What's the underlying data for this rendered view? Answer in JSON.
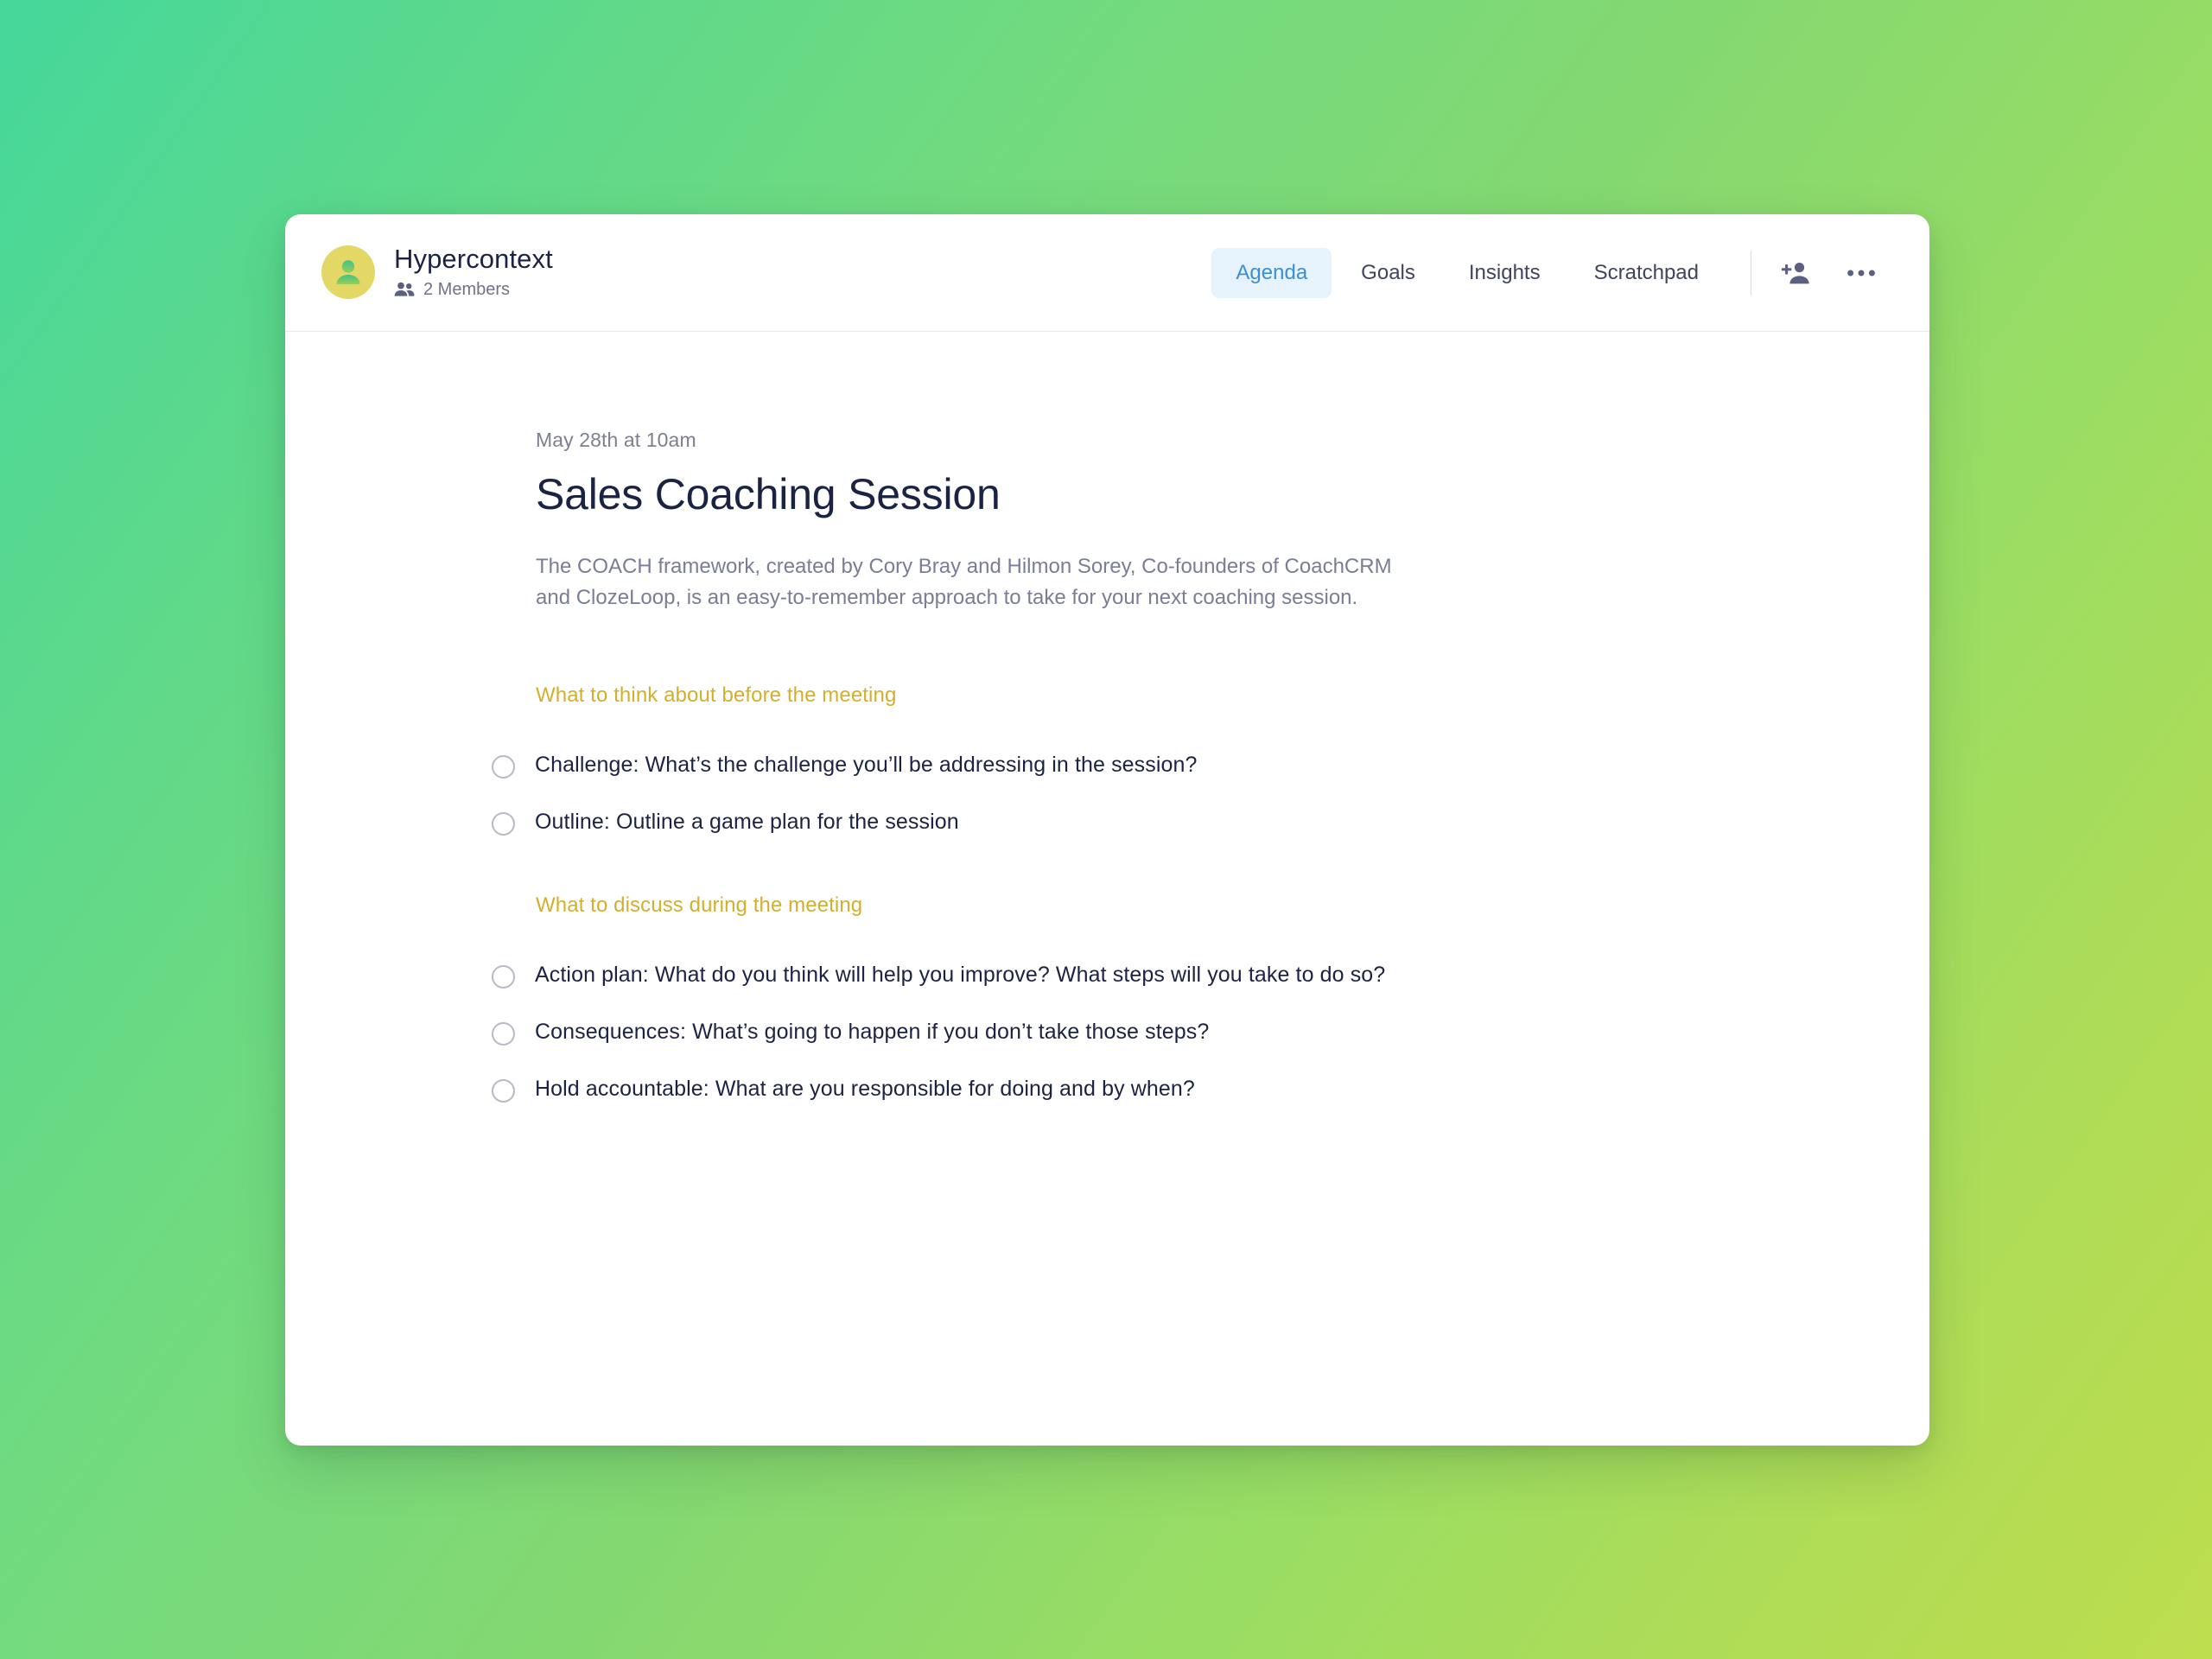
{
  "header": {
    "workspace_name": "Hypercontext",
    "members_label": "2 Members",
    "avatar_icon": "user-avatar-icon",
    "members_icon": "people-group-icon",
    "tabs": [
      {
        "label": "Agenda",
        "active": true
      },
      {
        "label": "Goals",
        "active": false
      },
      {
        "label": "Insights",
        "active": false
      },
      {
        "label": "Scratchpad",
        "active": false
      }
    ],
    "actions": [
      {
        "name": "add-member-button",
        "icon": "person-add-icon"
      },
      {
        "name": "more-options-button",
        "icon": "ellipsis-horizontal-icon"
      }
    ]
  },
  "meeting": {
    "date": "May 28th at 10am",
    "title": "Sales Coaching Session",
    "description": "The COACH framework, created by Cory Bray and Hilmon Sorey, Co-founders of CoachCRM and ClozeLoop, is an easy-to-remember approach to take for your next coaching session."
  },
  "sections": [
    {
      "heading": "What to think about before the meeting",
      "items": [
        {
          "text": "Challenge: What’s the challenge you’ll be addressing in the session?",
          "checked": false
        },
        {
          "text": "Outline: Outline a game plan for the session",
          "checked": false
        }
      ]
    },
    {
      "heading": "What to discuss during the meeting",
      "items": [
        {
          "text": "Action plan: What do you think will help you improve? What steps will you take to do so?",
          "checked": false
        },
        {
          "text": "Consequences: What’s going to happen if you don’t take those steps?",
          "checked": false
        },
        {
          "text": "Hold accountable: What are you responsible for doing and by when?",
          "checked": false
        }
      ]
    }
  ],
  "colors": {
    "accent_blue": "#3b8fd4",
    "tab_active_bg": "#e6f2fc",
    "section_heading": "#d4af2c",
    "text_primary": "#1b2344",
    "text_muted": "#797d97",
    "avatar_bg": "#e3d866",
    "background_gradient_start": "#45d79b",
    "background_gradient_end": "#bddd4e"
  }
}
